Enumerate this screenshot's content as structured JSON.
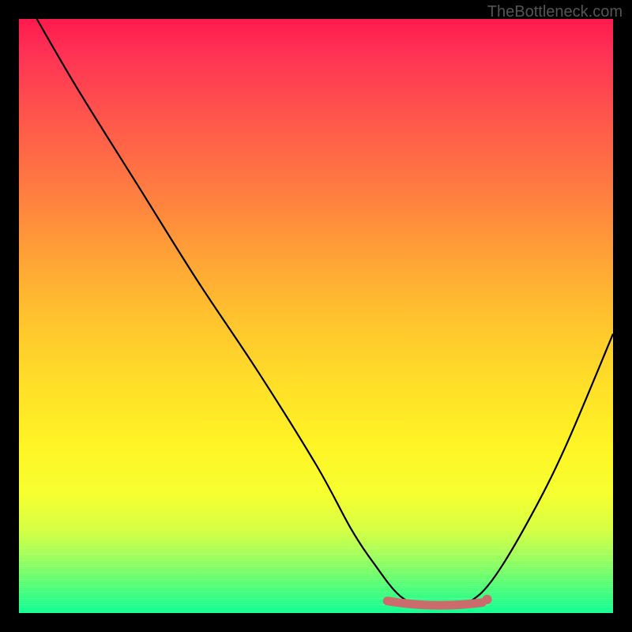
{
  "watermark": "TheBottleneck.com",
  "chart_data": {
    "type": "line",
    "title": "",
    "xlabel": "",
    "ylabel": "",
    "xlim": [
      0,
      100
    ],
    "ylim": [
      0,
      100
    ],
    "series": [
      {
        "name": "bottleneck-curve",
        "x": [
          3,
          10,
          20,
          30,
          40,
          50,
          56,
          60,
          64,
          68,
          72,
          76,
          80,
          86,
          92,
          100
        ],
        "y": [
          100,
          88,
          72,
          56,
          41,
          25,
          14,
          8,
          3,
          1,
          1,
          2,
          6,
          16,
          28,
          47
        ]
      }
    ],
    "flat_region": {
      "x_start": 62,
      "x_end": 78,
      "y": 1.5
    },
    "colors": {
      "curve": "#000000",
      "flat_marker": "#cc6b6b",
      "gradient_top": "#ff1a4d",
      "gradient_bottom": "#17ff95",
      "frame": "#000000"
    }
  }
}
